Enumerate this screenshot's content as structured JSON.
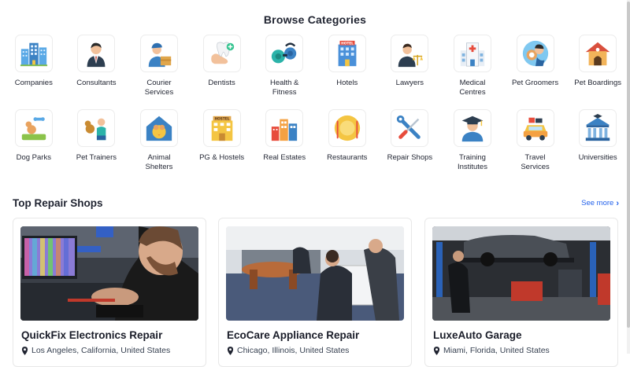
{
  "browse_title": "Browse Categories",
  "categories": [
    {
      "label": "Companies",
      "icon": "office-buildings-icon"
    },
    {
      "label": "Consultants",
      "icon": "businessman-icon"
    },
    {
      "label": "Courier\nServices",
      "icon": "courier-icon"
    },
    {
      "label": "Dentists",
      "icon": "tooth-icon"
    },
    {
      "label": "Health &\nFitness",
      "icon": "dumbbell-icon"
    },
    {
      "label": "Hotels",
      "icon": "hotel-icon"
    },
    {
      "label": "Lawyers",
      "icon": "lawyer-icon"
    },
    {
      "label": "Medical\nCentres",
      "icon": "hospital-icon"
    },
    {
      "label": "Pet Groomers",
      "icon": "pet-groomer-icon"
    },
    {
      "label": "Pet Boardings",
      "icon": "doghouse-icon"
    },
    {
      "label": "Dog Parks",
      "icon": "dog-park-icon"
    },
    {
      "label": "Pet Trainers",
      "icon": "pet-trainer-icon"
    },
    {
      "label": "Animal\nShelters",
      "icon": "animal-shelter-icon"
    },
    {
      "label": "PG & Hostels",
      "icon": "hostel-icon"
    },
    {
      "label": "Real Estates",
      "icon": "real-estate-icon"
    },
    {
      "label": "Restaurants",
      "icon": "plate-cutlery-icon"
    },
    {
      "label": "Repair Shops",
      "icon": "wrench-screwdriver-icon"
    },
    {
      "label": "Training\nInstitutes",
      "icon": "graduate-icon"
    },
    {
      "label": "Travel\nServices",
      "icon": "travel-car-icon"
    },
    {
      "label": "Universities",
      "icon": "university-icon"
    }
  ],
  "repair_section": {
    "title": "Top Repair Shops",
    "see_more": "See more",
    "shops": [
      {
        "name": "QuickFix Electronics Repair",
        "location": "Los Angeles, California, United States"
      },
      {
        "name": "EcoCare Appliance Repair",
        "location": "Chicago, Illinois, United States"
      },
      {
        "name": "LuxeAuto Garage",
        "location": "Miami, Florida, United States"
      }
    ]
  },
  "colors": {
    "accent": "#2563eb",
    "heading": "#1f2330"
  }
}
